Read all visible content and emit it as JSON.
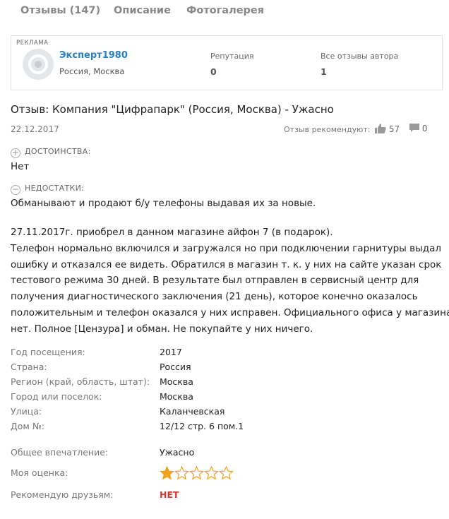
{
  "tabs": [
    {
      "label": "Отзывы (147)"
    },
    {
      "label": "Описание"
    },
    {
      "label": "Фотогалерея"
    }
  ],
  "author_card": {
    "ad_label": "РЕКЛАМА",
    "name": "Эксперт1980",
    "location": "Россия, Москва",
    "reputation_label": "Репутация",
    "reputation_value": "0",
    "reviews_label": "Все отзывы автора",
    "reviews_value": "1"
  },
  "review": {
    "title": "Отзыв: Компания \"Цифрапарк\" (Россия, Москва) - Ужасно",
    "date": "22.12.2017",
    "recommend_label": "Отзыв рекомендуют:",
    "likes": "57",
    "comments": "0",
    "pros_heading": "ДОСТОИНСТВА:",
    "pros_text": "Нет",
    "cons_heading": "НЕДОСТАТКИ:",
    "cons_text": "Обманывают и продают б/у телефоны выдавая их за новые.",
    "body_lines": [
      "27.11.2017г. приобрел в данном магазине айфон 7 (в подарок).",
      "Телефон нормально включился и загружался но при подключении гарнитуры выдал",
      "ошибку и отказался ее видеть. Обратился в магазин т. к. у них на сайте указан срок",
      "тестового режима 30 дней. В результате был отправлен в сервисный центр для",
      "получения диагностического заключения (21 день), которое конечно оказалось",
      "положительным и телефон оказался у них исправен. Официального офиса у магазина",
      "нет. Полное [Цензура] и обман. Не покупайте у них ничего."
    ]
  },
  "details": [
    {
      "label": "Год посещения:",
      "value": "2017"
    },
    {
      "label": "Страна:",
      "value": "Россия"
    },
    {
      "label": "Регион (край, область, штат):",
      "value": "Москва"
    },
    {
      "label": "Город или поселок:",
      "value": "Москва"
    },
    {
      "label": "Улица:",
      "value": "Каланчевская"
    },
    {
      "label": "Дом №:",
      "value": "12/12 стр. 6 пом.1"
    }
  ],
  "summary": {
    "impression_label": "Общее впечатление:",
    "impression_value": "Ужасно",
    "rating_label": "Моя оценка:",
    "rating": 1,
    "rating_max": 5,
    "recommend_label": "Рекомендую друзьям:",
    "recommend_value": "НЕТ"
  },
  "colors": {
    "link": "#2a7fc0",
    "star_filled": "#f0a31b",
    "star_empty": "#f0a31b",
    "negative": "#d9362b"
  },
  "icons": [
    "thumbs-up-icon",
    "comment-icon",
    "plus-circle-icon",
    "minus-circle-icon",
    "star-icon",
    "avatar-icon"
  ]
}
